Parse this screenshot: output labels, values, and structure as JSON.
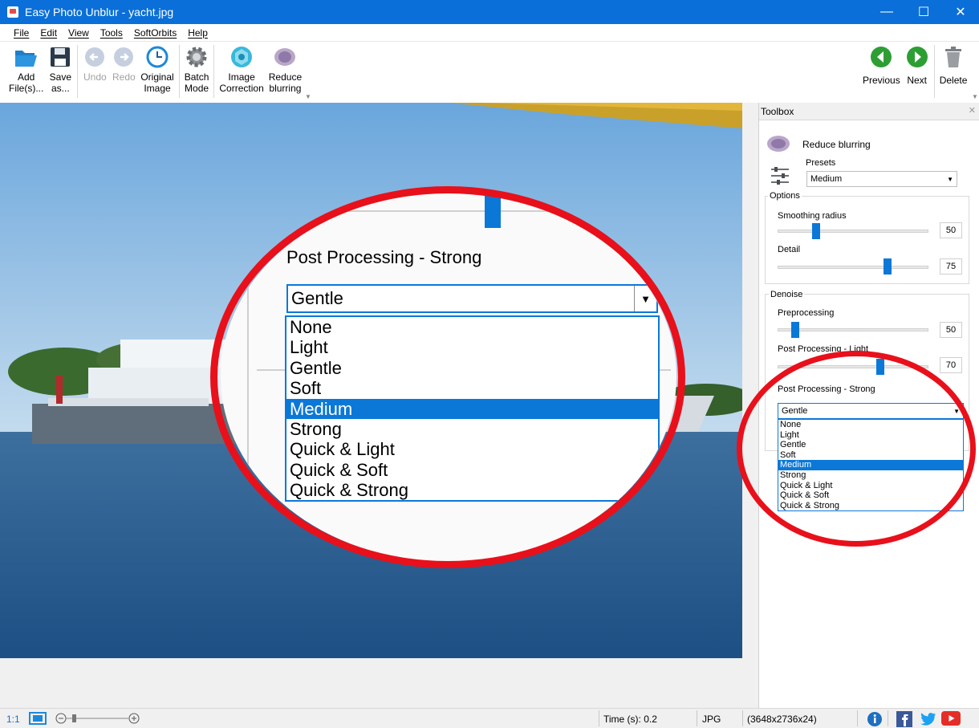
{
  "window": {
    "title": "Easy Photo Unblur - yacht.jpg",
    "min": "—",
    "max": "☐",
    "close": "✕"
  },
  "menu": [
    "File",
    "Edit",
    "View",
    "Tools",
    "SoftOrbits",
    "Help"
  ],
  "toolbar": {
    "add": "Add\nFile(s)...",
    "save": "Save\nas...",
    "undo": "Undo",
    "redo": "Redo",
    "original": "Original\nImage",
    "batch": "Batch\nMode",
    "correction": "Image\nCorrection",
    "reduce": "Reduce\nblurring",
    "previous": "Previous",
    "next": "Next",
    "delete": "Delete"
  },
  "toolbox": {
    "header": "Toolbox",
    "close": "✕",
    "tool_name": "Reduce blurring",
    "presets_label": "Presets",
    "presets_value": "Medium",
    "options_legend": "Options",
    "smoothing_label": "Smoothing radius",
    "smoothing_value": "50",
    "detail_label": "Detail",
    "detail_value": "75",
    "denoise_legend": "Denoise",
    "pre_label": "Preprocessing",
    "pre_value": "50",
    "ppl_label": "Post Processing - Light",
    "ppl_value": "70",
    "pps_label": "Post Processing - Strong",
    "pps_value": "Gentle",
    "options": [
      "None",
      "Light",
      "Gentle",
      "Soft",
      "Medium",
      "Strong",
      "Quick & Light",
      "Quick & Soft",
      "Quick & Strong"
    ],
    "highlighted": "Medium"
  },
  "zoom": {
    "title": "Post Processing - Strong",
    "value": "Gentle"
  },
  "status": {
    "ratio": "1:1",
    "time": "Time (s): 0.2",
    "format": "JPG",
    "dims": "(3648x2736x24)"
  },
  "colors": {
    "accent": "#0b78d7",
    "titlebar": "#0a6fd8",
    "ring": "#e8101a"
  }
}
